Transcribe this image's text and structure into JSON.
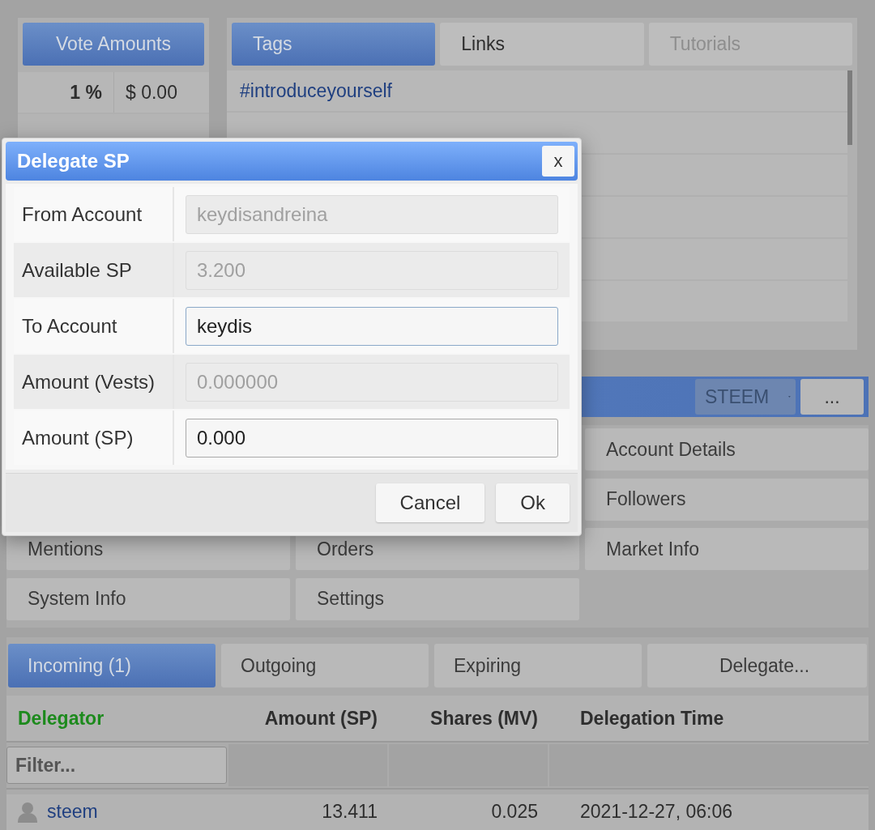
{
  "vote_amounts": {
    "title": "Vote Amounts",
    "rows": [
      {
        "percent": "1 %",
        "value": "$ 0.00"
      }
    ]
  },
  "tag_tabs": [
    {
      "label": "Tags",
      "selected": true,
      "disabled": false
    },
    {
      "label": "Links",
      "selected": false,
      "disabled": false
    },
    {
      "label": "Tutorials",
      "selected": false,
      "disabled": true
    }
  ],
  "tags": [
    "#introduceyourself"
  ],
  "currency_bar": {
    "currency": "STEEM",
    "more": "..."
  },
  "menu": [
    {
      "label": "Account Details"
    },
    {
      "label": "Followers"
    },
    {
      "label": "Mentions"
    },
    {
      "label": "Orders"
    },
    {
      "label": "Market Info"
    },
    {
      "label": "System Info"
    },
    {
      "label": "Settings"
    }
  ],
  "delegation_tabs": [
    {
      "label": "Incoming (1)",
      "selected": true
    },
    {
      "label": "Outgoing",
      "selected": false
    },
    {
      "label": "Expiring",
      "selected": false
    },
    {
      "label": "Delegate...",
      "selected": false
    }
  ],
  "delegation_table": {
    "columns": [
      {
        "label": "Delegator",
        "sorted": true
      },
      {
        "label": "Amount (SP)",
        "sorted": false
      },
      {
        "label": "Shares (MV)",
        "sorted": false
      },
      {
        "label": "Delegation Time",
        "sorted": false
      }
    ],
    "filter": {
      "placeholder": "Filter..."
    },
    "rows": [
      {
        "delegator": "steem",
        "amount": "13.411",
        "shares": "0.025",
        "time": "2021-12-27, 06:06"
      }
    ]
  },
  "dialog": {
    "title": "Delegate SP",
    "close": "x",
    "fields": [
      {
        "label": "From Account",
        "value": "keydisandreina",
        "disabled": true
      },
      {
        "label": "Available SP",
        "value": "3.200",
        "disabled": true
      },
      {
        "label": "To Account",
        "value": "keydis",
        "disabled": false
      },
      {
        "label": "Amount (Vests)",
        "value": "0.000000",
        "disabled": true
      },
      {
        "label": "Amount (SP)",
        "value": "0.000",
        "disabled": false
      }
    ],
    "buttons": [
      "Cancel",
      "Ok"
    ]
  }
}
